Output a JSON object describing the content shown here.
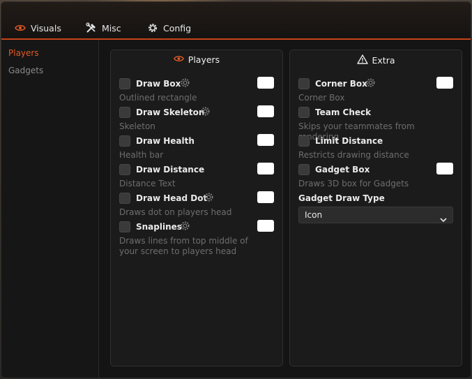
{
  "tabs": [
    {
      "label": "Visuals",
      "icon": "eye-icon",
      "active": true
    },
    {
      "label": "Misc",
      "icon": "tools-icon",
      "active": false
    },
    {
      "label": "Config",
      "icon": "gear-icon",
      "active": false
    }
  ],
  "sidebar": {
    "items": [
      {
        "label": "Players",
        "active": true
      },
      {
        "label": "Gadgets",
        "active": false
      }
    ]
  },
  "players_panel": {
    "title": "Players",
    "title_icon": "eye-icon",
    "options": [
      {
        "label": "Draw Box",
        "desc": "Outlined rectangle",
        "gear": true,
        "color": "#ffffff",
        "checked": false
      },
      {
        "label": "Draw Skeleton",
        "desc": "Skeleton",
        "gear": true,
        "color": "#ffffff",
        "checked": false
      },
      {
        "label": "Draw Health",
        "desc": "Health bar",
        "gear": false,
        "color": "#ffffff",
        "checked": false
      },
      {
        "label": "Draw Distance",
        "desc": "Distance Text",
        "gear": false,
        "color": "#ffffff",
        "checked": false
      },
      {
        "label": "Draw Head Dot",
        "desc": "Draws dot on players head",
        "gear": true,
        "color": "#ffffff",
        "checked": false
      },
      {
        "label": "Snaplines",
        "desc_line1": "Draws lines from top middle of",
        "desc_line2": "your screen to players head",
        "gear": true,
        "color": "#ffffff",
        "checked": false
      }
    ]
  },
  "extra_panel": {
    "title": "Extra",
    "title_icon": "warning-icon",
    "options": [
      {
        "label": "Corner Box",
        "desc": "Corner Box",
        "gear": true,
        "color": "#ffffff",
        "checked": false
      },
      {
        "label": "Team Check",
        "desc": "Skips your teammates from rendering",
        "gear": false,
        "checked": false
      },
      {
        "label": "Limit Distance",
        "desc": "Restricts drawing distance",
        "gear": false,
        "checked": false
      },
      {
        "label": "Gadget Box",
        "desc": "Draws 3D box for Gadgets",
        "gear": false,
        "color": "#ffffff",
        "checked": false
      }
    ],
    "gadget_draw_type": {
      "label": "Gadget Draw Type",
      "value": "Icon"
    }
  },
  "colors": {
    "accent": "#c6451a",
    "accent_text": "#e25a26"
  }
}
